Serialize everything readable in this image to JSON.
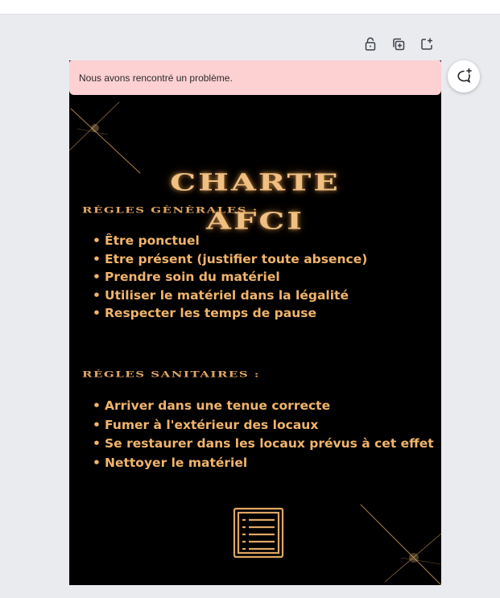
{
  "editor": {
    "toolbar": {
      "lock_icon": "lock-icon",
      "duplicate_icon": "duplicate-page-icon",
      "add_page_icon": "add-page-icon"
    },
    "comment_icon": "add-comment-icon"
  },
  "alert": {
    "message": "Nous avons rencontré un problème.",
    "background": "#fdd0d2"
  },
  "design": {
    "title_line1": "CHARTE",
    "title_line2": "AFCI",
    "sections": [
      {
        "heading": "RÉGLES GÈNÈRALES :",
        "items": [
          "Être ponctuel",
          "Etre présent (justifier toute absence)",
          "Prendre soin du matériel",
          "Utiliser le matériel dans la légalité",
          "Respecter les temps de pause"
        ]
      },
      {
        "heading": "RÉGLES SANITAIRES :",
        "items": [
          "Arriver dans une tenue correcte",
          "Fumer à l'extérieur des locaux",
          "Se restaurer dans les locaux prévus à cet effet",
          "Nettoyer le matériel"
        ]
      }
    ],
    "footer_icon": "document-list-icon",
    "colors": {
      "background": "#000000",
      "gold": "#f0b46c"
    }
  }
}
